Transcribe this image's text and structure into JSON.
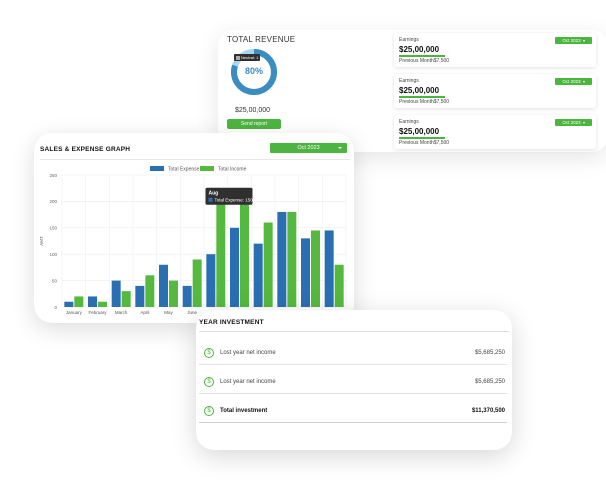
{
  "revenue": {
    "title": "TOTAL REVENUE",
    "donut_percent": "80%",
    "donut_fraction": 0.8,
    "tooltip_label": "Neutral: 1",
    "amount": "$25,00,000",
    "send_report_label": "Send report",
    "colors": {
      "ring": "#3a8cc1",
      "ring_light": "#a8d6f0",
      "accent": "#4cb53f"
    }
  },
  "earnings": [
    {
      "label": "Earnings",
      "value": "$25,00,000",
      "previous": "Previous Month$7,500",
      "dropdown": "Oct 2023"
    },
    {
      "label": "Earnings",
      "value": "$25,00,000",
      "previous": "Previous Month$7,500",
      "dropdown": "Oct 2023"
    },
    {
      "label": "Earnings",
      "value": "$25,00,000",
      "previous": "Previous Month$7,500",
      "dropdown": "Oct 2023"
    }
  ],
  "graph": {
    "title": "SALES & EXPENSE GRAPH",
    "dropdown": "Oct 2023",
    "tooltip": {
      "title": "Aug",
      "text": "Total Expense: 150"
    }
  },
  "chart_data": {
    "type": "bar",
    "categories": [
      "January",
      "February",
      "March",
      "April",
      "May",
      "June",
      "",
      "",
      "",
      "",
      "",
      ""
    ],
    "series": [
      {
        "name": "Total Expense",
        "color": "#2b6fb3",
        "values": [
          10,
          20,
          50,
          40,
          80,
          40,
          100,
          150,
          120,
          180,
          130,
          145
        ]
      },
      {
        "name": "Total Income",
        "color": "#55b93f",
        "values": [
          20,
          10,
          30,
          60,
          50,
          90,
          200,
          220,
          160,
          180,
          145,
          80
        ]
      }
    ],
    "yticks": [
      0,
      50,
      100,
      150,
      200,
      250
    ],
    "ylim": [
      0,
      250
    ],
    "ylabel": "AMT",
    "xlabel": "",
    "grid": true,
    "legend_position": "top-center"
  },
  "investment": {
    "title": "YEAR INVESTMENT",
    "rows": [
      {
        "label": "Lost year net income",
        "value": "$5,685,250"
      },
      {
        "label": "Lost year net income",
        "value": "$5,685,250"
      }
    ],
    "total": {
      "label": "Total investment",
      "value": "$11,370,500"
    },
    "currency_symbol": "$"
  }
}
